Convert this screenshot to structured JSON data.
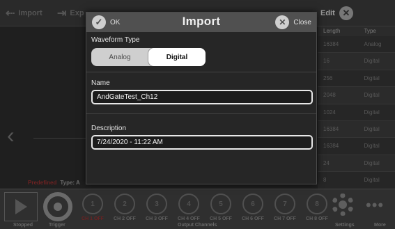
{
  "toolbar": {
    "import_label": "Import",
    "export_label": "Exp",
    "edit_label": "Edit"
  },
  "waveform_pane": {
    "predefined_label": "Predefined",
    "type_label": "Type:",
    "type_value": "A"
  },
  "table": {
    "headers": [
      "Length",
      "Type"
    ],
    "rows": [
      {
        "length": "16384",
        "type": "Analog"
      },
      {
        "length": "16",
        "type": "Digital"
      },
      {
        "length": "256",
        "type": "Digital"
      },
      {
        "length": "2048",
        "type": "Digital"
      },
      {
        "length": "1024",
        "type": "Digital"
      },
      {
        "length": "16384",
        "type": "Digital"
      },
      {
        "length": "16384",
        "type": "Digital"
      },
      {
        "length": "24",
        "type": "Digital"
      },
      {
        "length": "8",
        "type": "Digital"
      }
    ]
  },
  "bottombar": {
    "stopped_label": "Stopped",
    "trigger_label": "Trigger",
    "output_channels_label": "Output Channels",
    "settings_label": "Settings",
    "more_label": "More",
    "channels": [
      {
        "num": "1",
        "state": "CH 1 OFF"
      },
      {
        "num": "2",
        "state": "CH 2 OFF"
      },
      {
        "num": "3",
        "state": "CH 3 OFF"
      },
      {
        "num": "4",
        "state": "CH 4 OFF"
      },
      {
        "num": "5",
        "state": "CH 5 OFF"
      },
      {
        "num": "6",
        "state": "CH 6 OFF"
      },
      {
        "num": "7",
        "state": "CH 7 OFF"
      },
      {
        "num": "8",
        "state": "CH 8 OFF"
      }
    ]
  },
  "dialog": {
    "ok_label": "OK",
    "title": "Import",
    "close_label": "Close",
    "waveform_type_label": "Waveform Type",
    "waveform_type_options": [
      "Analog",
      "Digital"
    ],
    "waveform_type_selected": "Digital",
    "name_label": "Name",
    "name_value": "AndGateTest_Ch12",
    "description_label": "Description",
    "description_value": "7/24/2020 - 11:22 AM"
  },
  "colors": {
    "modal_header": "#505050",
    "modal_body": "#262626",
    "segment_selected": "#ffffff",
    "segment_unselected": "#cfcfcf",
    "accent_red": "#6d2222"
  },
  "icons": [
    "back-arrow-icon",
    "export-icon",
    "ok-check-icon",
    "close-x-icon",
    "edit-close-x-icon",
    "chevron-left-icon",
    "play-icon",
    "trigger-icon",
    "gear-icon",
    "more-dots-icon"
  ]
}
